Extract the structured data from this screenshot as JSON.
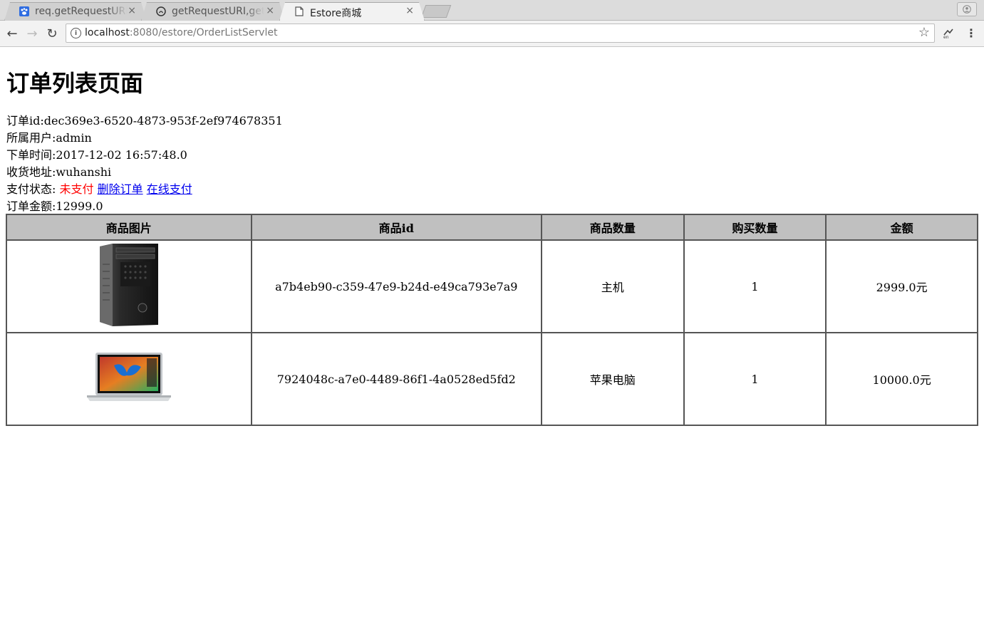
{
  "browser": {
    "tabs": [
      {
        "title": "req.getRequestURI",
        "icon": "baidu-paw-icon",
        "active": false
      },
      {
        "title": "getRequestURI,get",
        "icon": "github-icon",
        "active": false
      },
      {
        "title": "Estore商城",
        "icon": "page-icon",
        "active": true
      }
    ],
    "close_glyph": "×",
    "address": {
      "host": "localhost",
      "path": ":8080/estore/OrderListServlet"
    }
  },
  "page": {
    "title": "订单列表页面",
    "order": {
      "id_line": "订单id:dec369e3-6520-4873-953f-2ef974678351",
      "user_line": "所属用户:admin",
      "time_line": "下单时间:2017-12-02 16:57:48.0",
      "address_line": "收货地址:wuhanshi",
      "pay_status_label": "支付状态: ",
      "pay_status_value": "未支付",
      "delete_link": "删除订单",
      "pay_link": "在线支付",
      "amount_line": "订单金额:12999.0"
    },
    "table": {
      "headers": [
        "商品图片",
        "商品id",
        "商品数量",
        "购买数量",
        "金额"
      ],
      "rows": [
        {
          "image": "computer-tower-image",
          "product_id": "a7b4eb90-c359-47e9-b24d-e49ca793e7a9",
          "name": "主机",
          "quantity": "1",
          "amount": "2999.0元"
        },
        {
          "image": "laptop-image",
          "product_id": "7924048c-a7e0-4489-86f1-4a0528ed5fd2",
          "name": "苹果电脑",
          "quantity": "1",
          "amount": "10000.0元"
        }
      ]
    }
  }
}
